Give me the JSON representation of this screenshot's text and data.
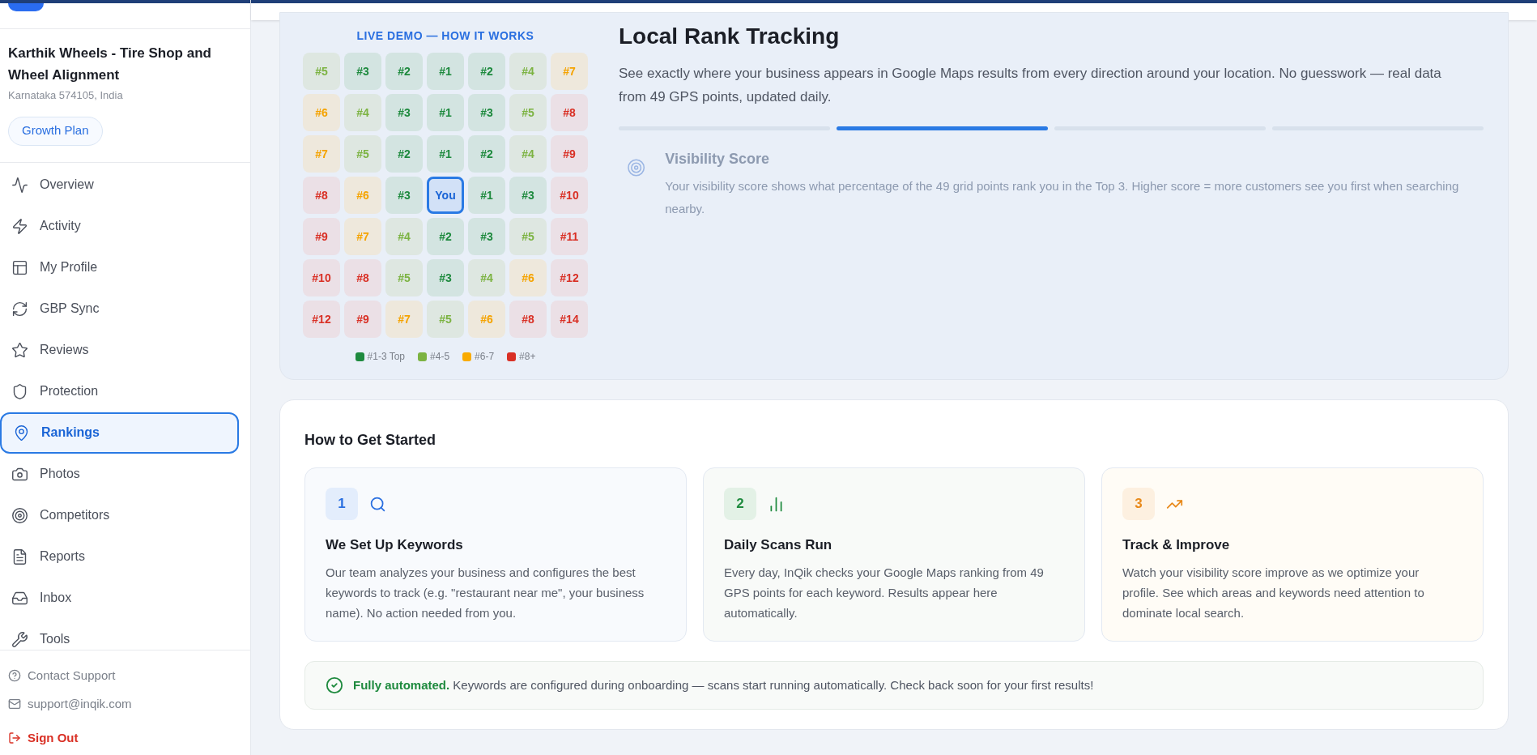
{
  "sidebar": {
    "business": {
      "name": "Karthik Wheels - Tire Shop and Wheel Alignment",
      "address": "Karnataka 574105, India",
      "plan": "Growth Plan"
    },
    "items": [
      {
        "label": "Overview",
        "selected": false
      },
      {
        "label": "Activity",
        "selected": false
      },
      {
        "label": "My Profile",
        "selected": false
      },
      {
        "label": "GBP Sync",
        "selected": false
      },
      {
        "label": "Reviews",
        "selected": false
      },
      {
        "label": "Protection",
        "selected": false
      },
      {
        "label": "Rankings",
        "selected": true
      },
      {
        "label": "Photos",
        "selected": false
      },
      {
        "label": "Competitors",
        "selected": false
      },
      {
        "label": "Reports",
        "selected": false
      },
      {
        "label": "Inbox",
        "selected": false
      },
      {
        "label": "Tools",
        "selected": false
      }
    ],
    "footer": {
      "contact": "Contact Support",
      "email": "support@inqik.com",
      "sign_out": "Sign Out"
    }
  },
  "demo": {
    "caption": "LIVE DEMO — HOW IT WORKS",
    "grid": [
      [
        {
          "label": "#5",
          "kind": "good"
        },
        {
          "label": "#3",
          "kind": "top"
        },
        {
          "label": "#2",
          "kind": "top"
        },
        {
          "label": "#1",
          "kind": "top"
        },
        {
          "label": "#2",
          "kind": "top"
        },
        {
          "label": "#4",
          "kind": "good"
        },
        {
          "label": "#7",
          "kind": "fair"
        }
      ],
      [
        {
          "label": "#6",
          "kind": "fair"
        },
        {
          "label": "#4",
          "kind": "good"
        },
        {
          "label": "#3",
          "kind": "top"
        },
        {
          "label": "#1",
          "kind": "top"
        },
        {
          "label": "#3",
          "kind": "top"
        },
        {
          "label": "#5",
          "kind": "good"
        },
        {
          "label": "#8",
          "kind": "poor"
        }
      ],
      [
        {
          "label": "#7",
          "kind": "fair"
        },
        {
          "label": "#5",
          "kind": "good"
        },
        {
          "label": "#2",
          "kind": "top"
        },
        {
          "label": "#1",
          "kind": "top"
        },
        {
          "label": "#2",
          "kind": "top"
        },
        {
          "label": "#4",
          "kind": "good"
        },
        {
          "label": "#9",
          "kind": "poor"
        }
      ],
      [
        {
          "label": "#8",
          "kind": "poor"
        },
        {
          "label": "#6",
          "kind": "fair"
        },
        {
          "label": "#3",
          "kind": "top"
        },
        {
          "label": "You",
          "kind": "you"
        },
        {
          "label": "#1",
          "kind": "top"
        },
        {
          "label": "#3",
          "kind": "top"
        },
        {
          "label": "#10",
          "kind": "poor"
        }
      ],
      [
        {
          "label": "#9",
          "kind": "poor"
        },
        {
          "label": "#7",
          "kind": "fair"
        },
        {
          "label": "#4",
          "kind": "good"
        },
        {
          "label": "#2",
          "kind": "top"
        },
        {
          "label": "#3",
          "kind": "top"
        },
        {
          "label": "#5",
          "kind": "good"
        },
        {
          "label": "#11",
          "kind": "poor"
        }
      ],
      [
        {
          "label": "#10",
          "kind": "poor"
        },
        {
          "label": "#8",
          "kind": "poor"
        },
        {
          "label": "#5",
          "kind": "good"
        },
        {
          "label": "#3",
          "kind": "top"
        },
        {
          "label": "#4",
          "kind": "good"
        },
        {
          "label": "#6",
          "kind": "fair"
        },
        {
          "label": "#12",
          "kind": "poor"
        }
      ],
      [
        {
          "label": "#12",
          "kind": "poor"
        },
        {
          "label": "#9",
          "kind": "poor"
        },
        {
          "label": "#7",
          "kind": "fair"
        },
        {
          "label": "#5",
          "kind": "good"
        },
        {
          "label": "#6",
          "kind": "fair"
        },
        {
          "label": "#8",
          "kind": "poor"
        },
        {
          "label": "#14",
          "kind": "poor"
        }
      ]
    ],
    "legend": [
      {
        "label": "#1-3 Top",
        "color": "#1e8a3e"
      },
      {
        "label": "#4-5",
        "color": "#7cb342"
      },
      {
        "label": "#6-7",
        "color": "#f9ab00"
      },
      {
        "label": "#8+",
        "color": "#d93025"
      }
    ],
    "title": "Local Rank Tracking",
    "description": "See exactly where your business appears in Google Maps results from every direction around your location. No guesswork — real data from 49 GPS points, updated daily.",
    "steps": [
      {
        "selected": false
      },
      {
        "selected": true
      },
      {
        "selected": false
      },
      {
        "selected": false
      }
    ],
    "slide": {
      "title": "Visibility Score",
      "text": "Your visibility score shows what percentage of the 49 grid points rank you in the Top 3. Higher score = more customers see you first when searching nearby."
    }
  },
  "get_started": {
    "title": "How to Get Started",
    "cards": [
      {
        "number": "1",
        "kind": "search",
        "title": "We Set Up Keywords",
        "text": "Our team analyzes your business and configures the best keywords to track (e.g. \"restaurant near me\", your business name). No action needed from you."
      },
      {
        "number": "2",
        "kind": "chart",
        "title": "Daily Scans Run",
        "text": "Every day, InQik checks your Google Maps ranking from 49 GPS points for each keyword. Results appear here automatically."
      },
      {
        "number": "3",
        "kind": "trend",
        "title": "Track & Improve",
        "text": "Watch your visibility score improve as we optimize your profile. See which areas and keywords need attention to dominate local search."
      }
    ],
    "notice": "**Fully automated.** Keywords are configured during onboarding — scans start running automatically. Check back soon for your first results!"
  }
}
